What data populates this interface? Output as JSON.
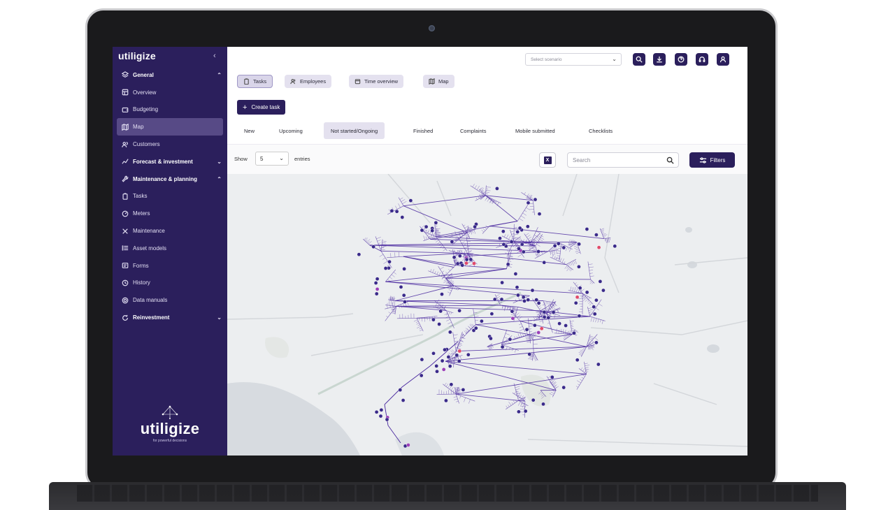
{
  "sidebar": {
    "logo_text": "utiligize",
    "collapse_icon": "chevron-left-icon",
    "items": [
      {
        "label": "General",
        "icon": "layers-icon",
        "type": "section",
        "chevron": "chevron-up-icon"
      },
      {
        "label": "Overview",
        "icon": "grid-icon",
        "type": "item"
      },
      {
        "label": "Budgeting",
        "icon": "wallet-icon",
        "type": "item"
      },
      {
        "label": "Map",
        "icon": "map-icon",
        "type": "item",
        "active": true
      },
      {
        "label": "Customers",
        "icon": "users-icon",
        "type": "item"
      },
      {
        "label": "Forecast & investment",
        "icon": "chart-icon",
        "type": "section",
        "chevron": "chevron-down-icon"
      },
      {
        "label": "Maintenance & planning",
        "icon": "wrench-icon",
        "type": "section",
        "chevron": "chevron-up-icon"
      },
      {
        "label": "Tasks",
        "icon": "clipboard-icon",
        "type": "item"
      },
      {
        "label": "Meters",
        "icon": "gauge-icon",
        "type": "item"
      },
      {
        "label": "Maintenance",
        "icon": "tools-icon",
        "type": "item"
      },
      {
        "label": "Asset models",
        "icon": "list-icon",
        "type": "item"
      },
      {
        "label": "Forms",
        "icon": "form-icon",
        "type": "item"
      },
      {
        "label": "History",
        "icon": "history-icon",
        "type": "item"
      },
      {
        "label": "Data manuals",
        "icon": "settings-icon",
        "type": "item"
      },
      {
        "label": "Reinvestment",
        "icon": "refresh-icon",
        "type": "section",
        "chevron": "chevron-down-icon"
      }
    ],
    "brand_name": "utiligize",
    "brand_tagline": "for powerful decisions"
  },
  "topbar": {
    "scenario_placeholder": "Select scenario",
    "buttons": [
      "search-icon",
      "download-icon",
      "help-icon",
      "headset-icon",
      "user-icon"
    ]
  },
  "tabs": [
    {
      "label": "Tasks",
      "icon": "clipboard-icon",
      "active": true
    },
    {
      "label": "Employees",
      "icon": "users-icon",
      "active": false
    },
    {
      "label": "Time overview",
      "icon": "calendar-icon",
      "active": false
    },
    {
      "label": "Map",
      "icon": "map-icon",
      "active": false
    }
  ],
  "create_task_label": "Create task",
  "status_tabs": [
    {
      "label": "New",
      "active": false
    },
    {
      "label": "Upcoming",
      "active": false
    },
    {
      "label": "Not started/Ongoing",
      "active": true
    },
    {
      "label": "Finished",
      "active": false
    },
    {
      "label": "Complaints",
      "active": false
    },
    {
      "label": "Mobile submitted",
      "active": false
    },
    {
      "label": "Checklists",
      "active": false
    }
  ],
  "entries": {
    "show_label": "Show",
    "page_size": "5",
    "entries_label": "entries",
    "search_placeholder": "Search",
    "filters_label": "Filters",
    "export_icon": "excel-icon"
  },
  "colors": {
    "brand": "#2b1f5c",
    "network_line": "#4b2aa0",
    "task_marker": "#3a2a8a",
    "task_marker_alt": "#9b3fb8",
    "task_marker_alert": "#e04a6a"
  }
}
